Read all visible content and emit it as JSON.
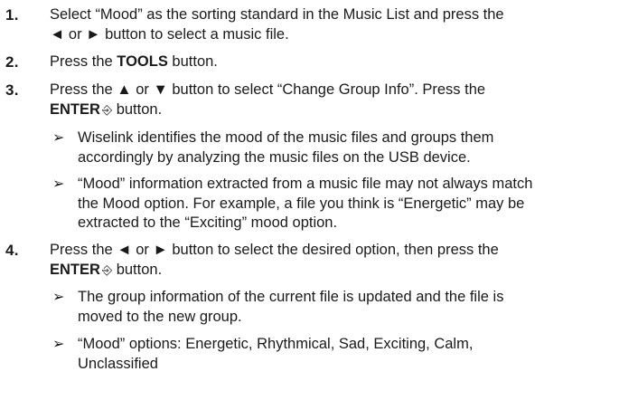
{
  "steps": [
    {
      "num": "1.",
      "line1": "Select “Mood” as the sorting standard in the Music List and press the",
      "line2": "◄ or ► button to select a music file."
    },
    {
      "num": "2.",
      "pre": "Press the ",
      "bold": "TOOLS",
      "post": " button."
    },
    {
      "num": "3.",
      "line1": "Press the ▲ or ▼ button to select “Change Group Info”. Press the",
      "bold": "ENTER",
      "icon_glyph": "⎆",
      "post": " button.",
      "notes": [
        {
          "line1": "Wiselink identifies the mood of the music files and groups them",
          "line2": "accordingly by analyzing the music files on the USB device."
        },
        {
          "line1": "“Mood” information extracted from a music file may not always match",
          "line2": "the Mood option. For example, a file you think is “Energetic” may be",
          "line3": "extracted to the “Exciting” mood option."
        }
      ]
    },
    {
      "num": "4.",
      "line1": "Press the ◄ or ► button to select the desired option, then press the",
      "bold": "ENTER",
      "icon_glyph": "⎆",
      "post": " button.",
      "notes": [
        {
          "line1": "The group information of the current file is updated and the file is",
          "line2": "moved to the new group."
        },
        {
          "line1": "“Mood” options: Energetic, Rhythmical, Sad, Exciting, Calm,",
          "line2": "Unclassified"
        }
      ]
    }
  ],
  "note_marker": "➢"
}
